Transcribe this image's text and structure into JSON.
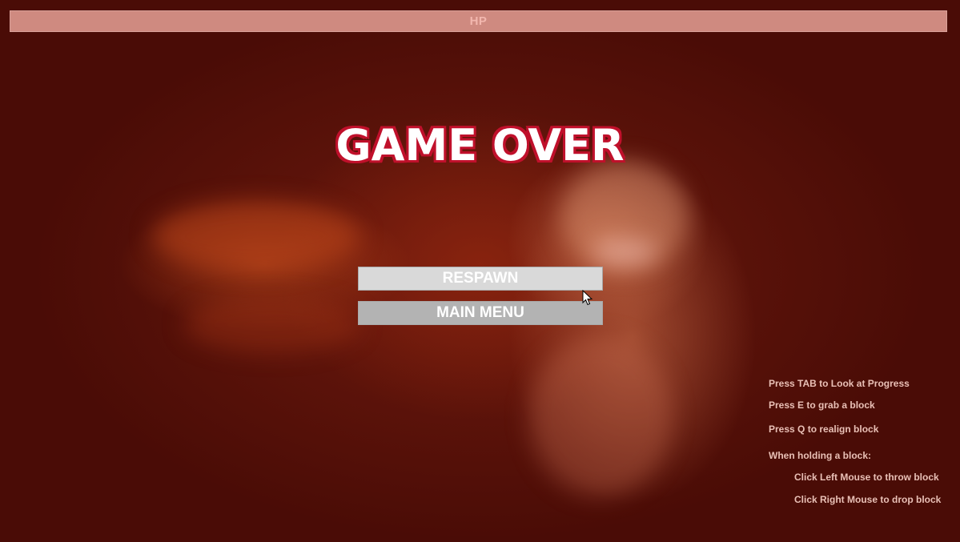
{
  "hud": {
    "hp_label": "HP"
  },
  "game_over": {
    "title": "GAME OVER",
    "respawn_label": "RESPAWN",
    "main_menu_label": "MAIN MENU"
  },
  "controls": {
    "tab_hint": "Press TAB to Look at Progress",
    "grab_hint": "Press E to grab a block",
    "realign_hint": "Press Q to realign block",
    "holding_header": "When holding a block:",
    "throw_hint": "Click Left Mouse to throw block",
    "drop_hint": "Click Right Mouse to drop block"
  },
  "colors": {
    "background": "#4a0c06",
    "hp_bar": "#cf8a80",
    "title_outline": "#c0102b"
  },
  "icons": {
    "cursor": "mouse-pointer-icon"
  }
}
